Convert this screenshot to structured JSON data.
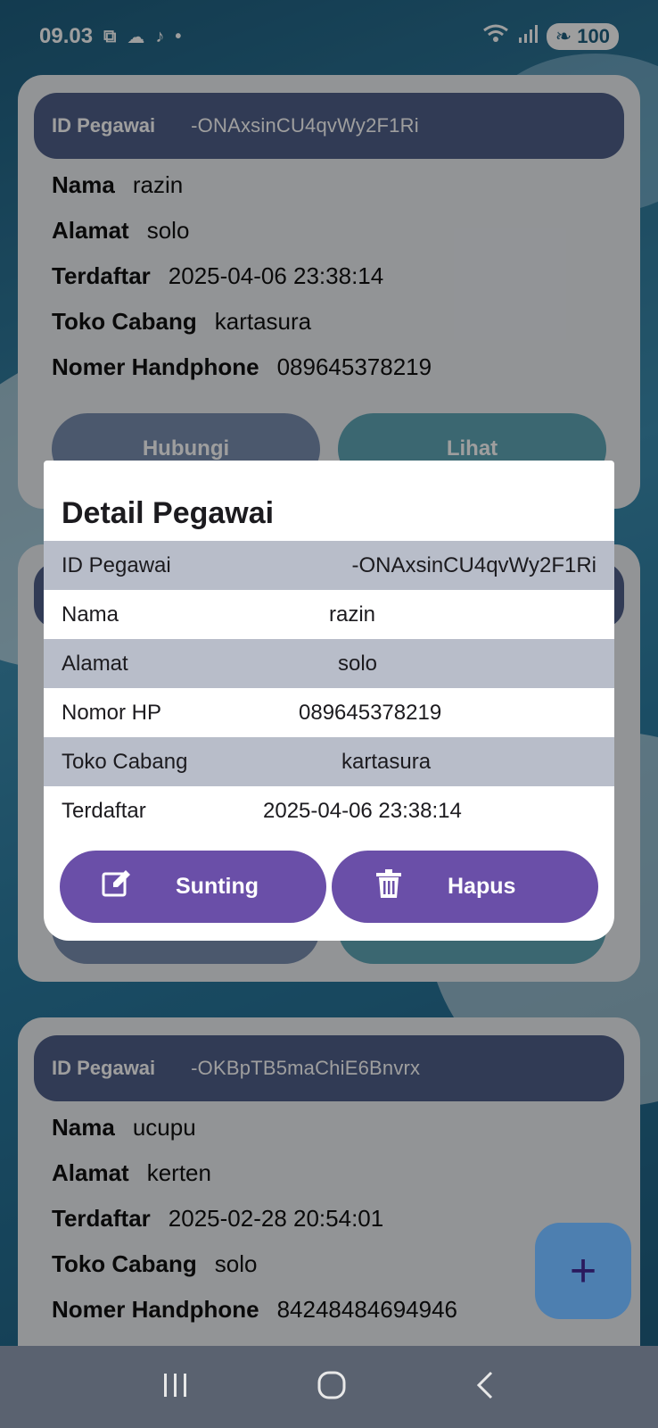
{
  "status_bar": {
    "time": "09.03",
    "battery": "100"
  },
  "cards": [
    {
      "id_label": "ID Pegawai",
      "id_value": "-ONAxsinCU4qvWy2F1Ri",
      "rows": [
        {
          "label": "Nama",
          "value": "razin"
        },
        {
          "label": "Alamat",
          "value": "solo"
        },
        {
          "label": "Terdaftar",
          "value": "2025-04-06 23:38:14"
        },
        {
          "label": "Toko Cabang",
          "value": "kartasura"
        },
        {
          "label": "Nomer Handphone",
          "value": "089645378219"
        }
      ],
      "buttons": {
        "contact": "Hubungi",
        "view": "Lihat"
      }
    },
    {
      "id_label": "ID Pegawai",
      "id_value": "-OKBpTB5maChiE6Bnvrx",
      "rows": [
        {
          "label": "Nama",
          "value": "ucupu"
        },
        {
          "label": "Alamat",
          "value": "kerten"
        },
        {
          "label": "Terdaftar",
          "value": "2025-02-28 20:54:01"
        },
        {
          "label": "Toko Cabang",
          "value": "solo"
        },
        {
          "label": "Nomer Handphone",
          "value": "84248484694946"
        }
      ]
    }
  ],
  "dialog": {
    "title": "Detail Pegawai",
    "rows": [
      {
        "label": "ID Pegawai",
        "value": "-ONAxsinCU4qvWy2F1Ri"
      },
      {
        "label": "Nama",
        "value": "razin"
      },
      {
        "label": "Alamat",
        "value": "solo"
      },
      {
        "label": "Nomor HP",
        "value": "089645378219"
      },
      {
        "label": "Toko Cabang",
        "value": "kartasura"
      },
      {
        "label": "Terdaftar",
        "value": "2025-04-06 23:38:14"
      }
    ],
    "edit_label": "Sunting",
    "delete_label": "Hapus"
  },
  "fab": {
    "icon": "plus-icon",
    "symbol": "+"
  },
  "colors": {
    "dialog_button": "#6a4fa8",
    "row_shade": "#b8bdc9",
    "card_header": "#4f5f8a"
  }
}
